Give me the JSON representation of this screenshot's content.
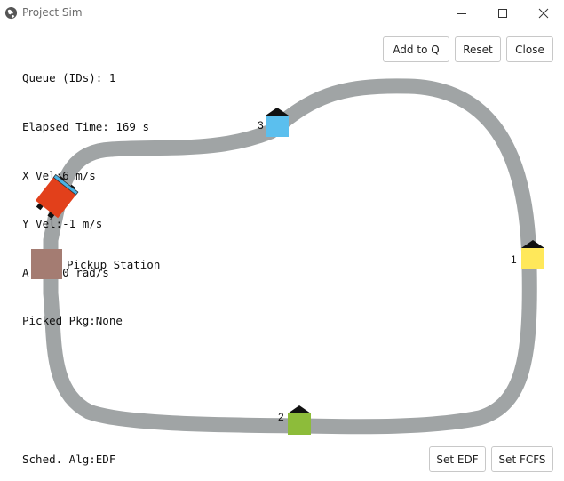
{
  "window": {
    "title": "Project Sim"
  },
  "stats": {
    "queue": "Queue (IDs): 1",
    "elapsed": "Elapsed Time: 169 s",
    "x_vel": "X Vel:6 m/s",
    "y_vel": "Y Vel:-1 m/s",
    "a_vel": "A Vel:0 rad/s",
    "picked": "Picked Pkg:None"
  },
  "toolbar": {
    "add_label": "Add to Q",
    "reset_label": "Reset",
    "close_label": "Close"
  },
  "scheduler": {
    "status": "Sched. Alg:EDF",
    "set_edf_label": "Set EDF",
    "set_fcfs_label": "Set FCFS"
  },
  "map": {
    "pickup_label": "Pickup Station",
    "destinations": [
      {
        "id": "1",
        "color": "#ffe85a"
      },
      {
        "id": "2",
        "color": "#8dbc3a"
      },
      {
        "id": "3",
        "color": "#5bbfee"
      }
    ],
    "track_color": "#a0a4a5",
    "station_color": "#a47c72",
    "robot_color": "#e2401b"
  }
}
